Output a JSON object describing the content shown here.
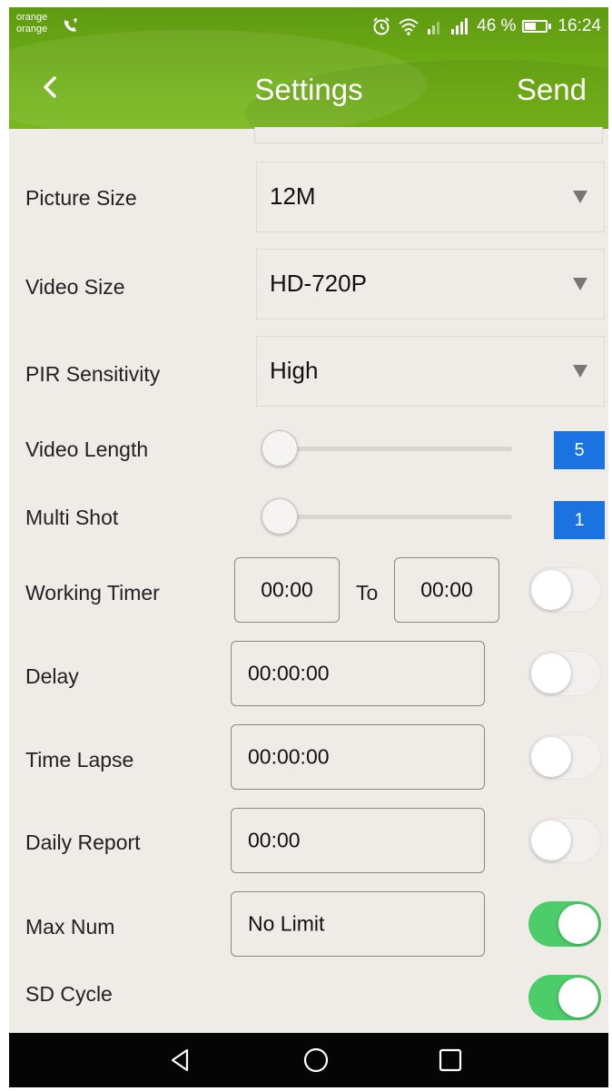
{
  "status_bar": {
    "carrier_line1": "orange",
    "carrier_line2": "orange",
    "battery_text": "46 %",
    "time": "16:24",
    "icons": [
      "call-icon",
      "alarm-icon",
      "wifi-icon",
      "signal-icon",
      "battery-icon"
    ]
  },
  "header": {
    "back_icon": "chevron-left-icon",
    "title": "Settings",
    "send_label": "Send",
    "bg_color": "#6aa814"
  },
  "settings": {
    "picture_size": {
      "label": "Picture Size",
      "value": "12M"
    },
    "video_size": {
      "label": "Video Size",
      "value": "HD-720P"
    },
    "pir_sensitivity": {
      "label": "PIR Sensitivity",
      "value": "High"
    },
    "video_length": {
      "label": "Video Length",
      "value": "5",
      "slider_fraction": 0
    },
    "multi_shot": {
      "label": "Multi Shot",
      "value": "1",
      "slider_fraction": 0
    },
    "working_timer": {
      "label": "Working Timer",
      "from": "00:00",
      "to_label": "To",
      "to": "00:00",
      "enabled": false
    },
    "delay": {
      "label": "Delay",
      "value": "00:00:00",
      "enabled": false
    },
    "time_lapse": {
      "label": "Time Lapse",
      "value": "00:00:00",
      "enabled": false
    },
    "daily_report": {
      "label": "Daily Report",
      "value": "00:00",
      "enabled": false
    },
    "max_num": {
      "label": "Max Num",
      "value": "No Limit",
      "enabled": true
    },
    "sd_cycle": {
      "label": "SD Cycle",
      "enabled": true
    }
  },
  "colors": {
    "accent_blue": "#1a73e0",
    "toggle_on": "#4ccd6a",
    "header_green": "#6aa814"
  },
  "navbar": {
    "icons": [
      "back-triangle-icon",
      "home-circle-icon",
      "recents-square-icon"
    ]
  }
}
